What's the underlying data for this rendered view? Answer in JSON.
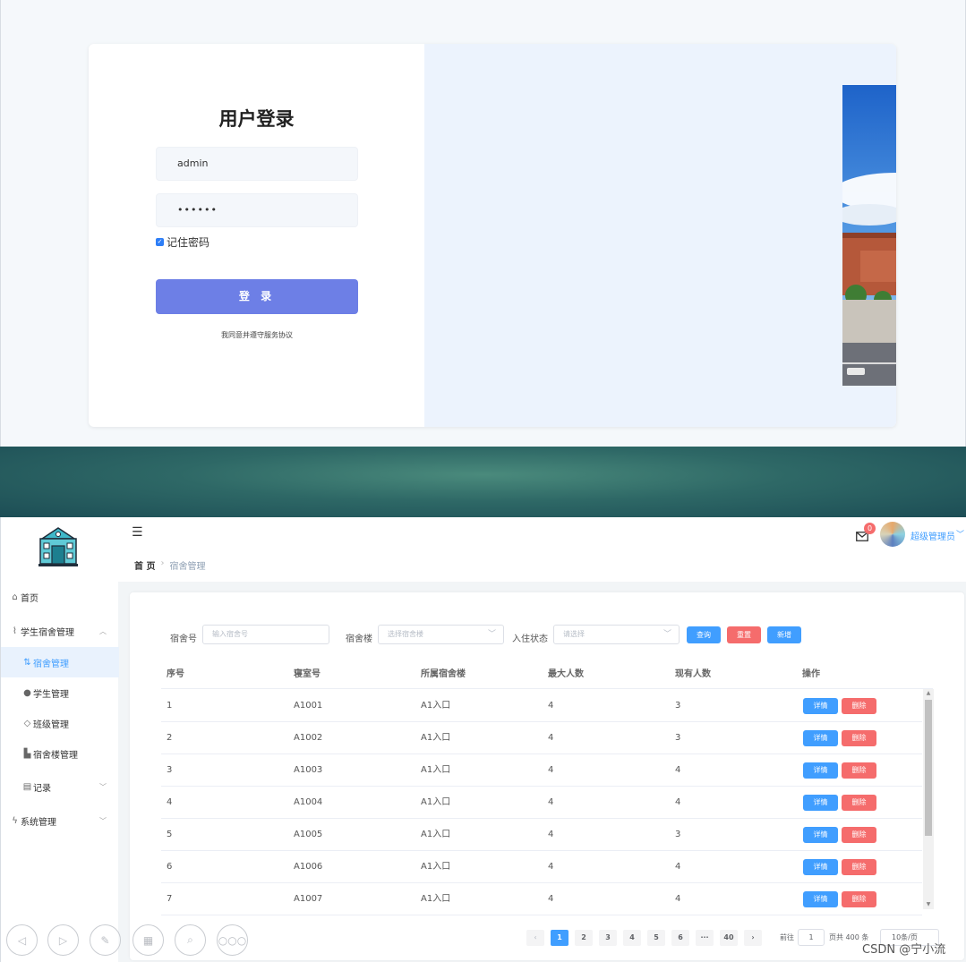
{
  "login": {
    "title": "用户登录",
    "username_value": "admin",
    "password_value": "••••••",
    "remember_label": "记住密码",
    "remember_checked": true,
    "login_button": "登 录",
    "agreement": "我同意并遵守服务协议"
  },
  "admin": {
    "sidebar": {
      "items": [
        {
          "label": "首页",
          "icon": "home-icon"
        },
        {
          "label": "学生宿舍管理",
          "icon": "paperclip-icon"
        },
        {
          "label": "宿舍管理",
          "icon": "swap-icon"
        },
        {
          "label": "学生管理",
          "icon": "user-icon"
        },
        {
          "label": "班级管理",
          "icon": "layers-icon"
        },
        {
          "label": "宿舍楼管理",
          "icon": "building-icon"
        },
        {
          "label": "记录",
          "icon": "document-icon"
        },
        {
          "label": "系统管理",
          "icon": "lightning-icon"
        }
      ]
    },
    "header": {
      "badge_count": "0",
      "user_name": "超级管理员"
    },
    "breadcrumb": {
      "home": "首 页",
      "current": "宿舍管理"
    },
    "filters": {
      "room_label": "宿舍号",
      "room_placeholder": "输入宿舍号",
      "building_label": "宿舍楼",
      "building_placeholder": "选择宿舍楼",
      "status_label": "入住状态",
      "status_placeholder": "请选择",
      "query_button": "查询",
      "reset_button": "重置",
      "add_button": "新增"
    },
    "table": {
      "columns": [
        "序号",
        "寝室号",
        "所属宿舍楼",
        "最大人数",
        "现有人数",
        "操作"
      ],
      "detail_label": "详情",
      "delete_label": "删除",
      "rows": [
        [
          "1",
          "A1001",
          "A1入口",
          "4",
          "3"
        ],
        [
          "2",
          "A1002",
          "A1入口",
          "4",
          "3"
        ],
        [
          "3",
          "A1003",
          "A1入口",
          "4",
          "4"
        ],
        [
          "4",
          "A1004",
          "A1入口",
          "4",
          "4"
        ],
        [
          "5",
          "A1005",
          "A1入口",
          "4",
          "3"
        ],
        [
          "6",
          "A1006",
          "A1入口",
          "4",
          "4"
        ],
        [
          "7",
          "A1007",
          "A1入口",
          "4",
          "4"
        ]
      ]
    },
    "pagination": {
      "pages": [
        "1",
        "2",
        "3",
        "4",
        "5",
        "6",
        "···",
        "40"
      ],
      "current_page": "1",
      "goto_label": "前往",
      "goto_value": "1",
      "total_label": "页共 400 条",
      "page_size": "10条/页"
    }
  },
  "watermark": "CSDN @宁小流"
}
